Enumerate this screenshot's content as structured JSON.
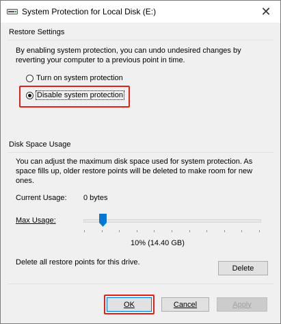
{
  "window": {
    "title": "System Protection for Local Disk (E:)",
    "close_glyph": "✕"
  },
  "restore_settings": {
    "group_label": "Restore Settings",
    "description_line1": "By enabling system protection, you can undo undesired changes by",
    "description_line2": "reverting your computer to a previous point in time.",
    "options": [
      {
        "label": "Turn on system protection",
        "selected": false
      },
      {
        "label": "Disable system protection",
        "selected": true
      }
    ]
  },
  "disk_space": {
    "group_label": "Disk Space Usage",
    "description_line1": "You can adjust the maximum disk space used for system protection. As",
    "description_line2": "space fills up, older restore points will be deleted to make room for new",
    "description_line3": "ones.",
    "current_usage_label": "Current Usage:",
    "current_usage_value": "0 bytes",
    "max_usage_label": "Max Usage:",
    "max_usage_percent": 10,
    "max_usage_display": "10% (14.40 GB)",
    "delete_text": "Delete all restore points for this drive.",
    "delete_button": "Delete"
  },
  "footer": {
    "ok": "OK",
    "cancel": "Cancel",
    "apply": "Apply"
  },
  "colors": {
    "highlight": "#e0201b",
    "slider_thumb": "#0078d7"
  }
}
